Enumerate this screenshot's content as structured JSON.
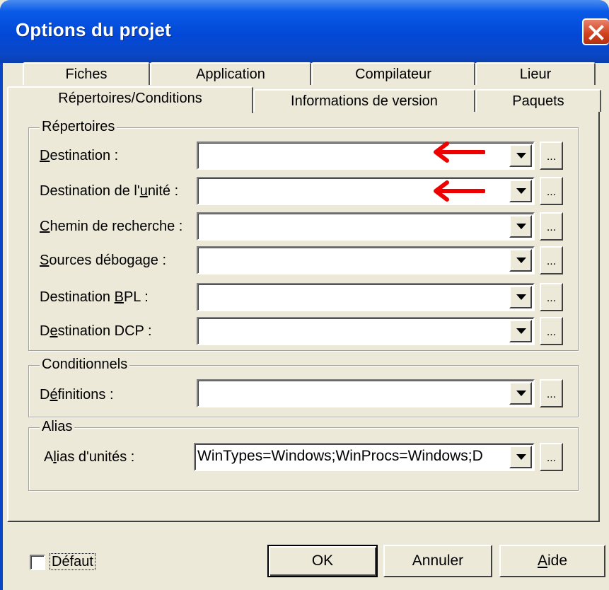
{
  "window": {
    "title": "Options du projet",
    "close_icon": "close-icon"
  },
  "tabs": {
    "row_back": [
      "Fiches",
      "Application",
      "Compilateur",
      "Lieur"
    ],
    "row_front": [
      "Répertoires/Conditions",
      "Informations de version",
      "Paquets"
    ],
    "active": "Répertoires/Conditions"
  },
  "repertoires": {
    "title": "Répertoires",
    "fields": [
      {
        "label_pre": "",
        "label_key": "D",
        "label_post": "estination :",
        "value": ""
      },
      {
        "label_pre": "Destination de l'",
        "label_key": "u",
        "label_post": "nité :",
        "value": ""
      },
      {
        "label_pre": "",
        "label_key": "C",
        "label_post": "hemin de recherche :",
        "value": ""
      },
      {
        "label_pre": "",
        "label_key": "S",
        "label_post": "ources débogage :",
        "value": ""
      },
      {
        "label_pre": "Destination ",
        "label_key": "B",
        "label_post": "PL :",
        "value": ""
      },
      {
        "label_pre": "D",
        "label_key": "e",
        "label_post": "stination DCP :",
        "value": ""
      }
    ]
  },
  "conditionnels": {
    "title": "Conditionnels",
    "field": {
      "label_pre": "D",
      "label_key": "é",
      "label_post": "finitions :",
      "value": ""
    }
  },
  "alias": {
    "title": "Alias",
    "field": {
      "label_pre": "A",
      "label_key": "l",
      "label_post": "ias d'unités :",
      "value": "WinTypes=Windows;WinProcs=Windows;D"
    }
  },
  "browse_label": "...",
  "footer": {
    "default_checkbox": {
      "label": "Défaut",
      "checked": false
    },
    "ok": "OK",
    "cancel": "Annuler",
    "help_key": "A",
    "help_rest": "ide"
  },
  "annotations": {
    "arrow_color": "#ee0000",
    "arrows": [
      "red-arrow-icon",
      "red-arrow-icon"
    ]
  }
}
